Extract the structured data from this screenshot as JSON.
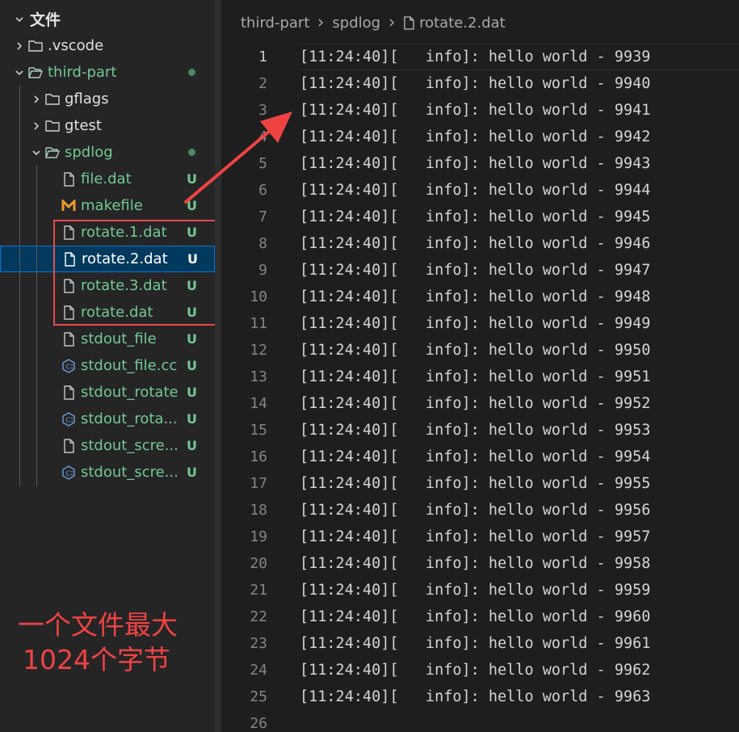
{
  "explorer": {
    "section_title": "文件",
    "items": [
      {
        "label": ".vscode",
        "kind": "folder",
        "state": "collapsed",
        "depth": 1,
        "badge": ""
      },
      {
        "label": "third-part",
        "kind": "folder",
        "state": "expanded",
        "depth": 1,
        "badge": "dot"
      },
      {
        "label": "gflags",
        "kind": "folder",
        "state": "collapsed",
        "depth": 2,
        "badge": ""
      },
      {
        "label": "gtest",
        "kind": "folder",
        "state": "collapsed",
        "depth": 2,
        "badge": ""
      },
      {
        "label": "spdlog",
        "kind": "folder",
        "state": "expanded",
        "depth": 2,
        "badge": "dot"
      },
      {
        "label": "file.dat",
        "kind": "file",
        "depth": 3,
        "badge": "U"
      },
      {
        "label": "makefile",
        "kind": "makefile",
        "depth": 3,
        "badge": "U"
      },
      {
        "label": "rotate.1.dat",
        "kind": "file",
        "depth": 3,
        "badge": "U"
      },
      {
        "label": "rotate.2.dat",
        "kind": "file",
        "depth": 3,
        "badge": "U",
        "selected": true
      },
      {
        "label": "rotate.3.dat",
        "kind": "file",
        "depth": 3,
        "badge": "U"
      },
      {
        "label": "rotate.dat",
        "kind": "file",
        "depth": 3,
        "badge": "U"
      },
      {
        "label": "stdout_file",
        "kind": "file",
        "depth": 3,
        "badge": "U"
      },
      {
        "label": "stdout_file.cc",
        "kind": "cpp",
        "depth": 3,
        "badge": "U"
      },
      {
        "label": "stdout_rotate",
        "kind": "file",
        "depth": 3,
        "badge": "U"
      },
      {
        "label": "stdout_rota...",
        "kind": "cpp",
        "depth": 3,
        "badge": "U"
      },
      {
        "label": "stdout_scre...",
        "kind": "file",
        "depth": 3,
        "badge": "U"
      },
      {
        "label": "stdout_scre...",
        "kind": "cpp",
        "depth": 3,
        "badge": "U"
      }
    ]
  },
  "breadcrumb": [
    "third-part",
    "spdlog",
    "rotate.2.dat"
  ],
  "editor": {
    "active_line": 1,
    "lines": [
      {
        "n": "1",
        "text": "[11:24:40][   info]: hello world - 9939"
      },
      {
        "n": "2",
        "text": "[11:24:40][   info]: hello world - 9940"
      },
      {
        "n": "3",
        "text": "[11:24:40][   info]: hello world - 9941"
      },
      {
        "n": "4",
        "text": "[11:24:40][   info]: hello world - 9942"
      },
      {
        "n": "5",
        "text": "[11:24:40][   info]: hello world - 9943"
      },
      {
        "n": "6",
        "text": "[11:24:40][   info]: hello world - 9944"
      },
      {
        "n": "7",
        "text": "[11:24:40][   info]: hello world - 9945"
      },
      {
        "n": "8",
        "text": "[11:24:40][   info]: hello world - 9946"
      },
      {
        "n": "9",
        "text": "[11:24:40][   info]: hello world - 9947"
      },
      {
        "n": "10",
        "text": "[11:24:40][   info]: hello world - 9948"
      },
      {
        "n": "11",
        "text": "[11:24:40][   info]: hello world - 9949"
      },
      {
        "n": "12",
        "text": "[11:24:40][   info]: hello world - 9950"
      },
      {
        "n": "13",
        "text": "[11:24:40][   info]: hello world - 9951"
      },
      {
        "n": "14",
        "text": "[11:24:40][   info]: hello world - 9952"
      },
      {
        "n": "15",
        "text": "[11:24:40][   info]: hello world - 9953"
      },
      {
        "n": "16",
        "text": "[11:24:40][   info]: hello world - 9954"
      },
      {
        "n": "17",
        "text": "[11:24:40][   info]: hello world - 9955"
      },
      {
        "n": "18",
        "text": "[11:24:40][   info]: hello world - 9956"
      },
      {
        "n": "19",
        "text": "[11:24:40][   info]: hello world - 9957"
      },
      {
        "n": "20",
        "text": "[11:24:40][   info]: hello world - 9958"
      },
      {
        "n": "21",
        "text": "[11:24:40][   info]: hello world - 9959"
      },
      {
        "n": "22",
        "text": "[11:24:40][   info]: hello world - 9960"
      },
      {
        "n": "23",
        "text": "[11:24:40][   info]: hello world - 9961"
      },
      {
        "n": "24",
        "text": "[11:24:40][   info]: hello world - 9962"
      },
      {
        "n": "25",
        "text": "[11:24:40][   info]: hello world - 9963"
      },
      {
        "n": "26",
        "text": ""
      }
    ]
  },
  "annotation": {
    "note_line1": "一个文件最大",
    "note_line2": "1024个字节",
    "color": "#ef4343"
  },
  "icons": {
    "chevron_right": "chevron-right-icon",
    "chevron_down": "chevron-down-icon",
    "folder": "folder-icon",
    "folder_open": "folder-open-icon",
    "file": "file-icon",
    "makefile": "makefile-icon",
    "cpp": "cpp-icon"
  }
}
